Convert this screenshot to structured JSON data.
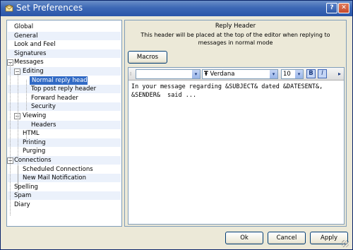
{
  "window": {
    "title": "Set Preferences",
    "help_glyph": "?",
    "close_glyph": "✕"
  },
  "tree": {
    "items": [
      {
        "label": "Global"
      },
      {
        "label": "General"
      },
      {
        "label": "Look and Feel"
      },
      {
        "label": "Signatures"
      },
      {
        "label": "Messages",
        "expanded": true
      },
      {
        "label": "Editing",
        "expanded": true
      },
      {
        "label": "Normal reply header",
        "selected": true
      },
      {
        "label": "Top post reply header"
      },
      {
        "label": "Forward header"
      },
      {
        "label": "Security"
      },
      {
        "label": "Viewing",
        "expanded": true
      },
      {
        "label": "Headers"
      },
      {
        "label": "HTML"
      },
      {
        "label": "Printing"
      },
      {
        "label": "Purging"
      },
      {
        "label": "Connections",
        "expanded": true
      },
      {
        "label": "Scheduled Connections"
      },
      {
        "label": "New Mail Notification"
      },
      {
        "label": "Spelling"
      },
      {
        "label": "Spam"
      },
      {
        "label": "Diary"
      }
    ],
    "expander_glyph": "−"
  },
  "panel": {
    "title": "Reply Header",
    "description": "This header will be placed at the top of the editor when replying to messages in normal mode",
    "macros_label": "Macros"
  },
  "editor": {
    "style_combo_value": "",
    "font_value": "Verdana",
    "font_icon": "truetype-icon",
    "font_glyph": "Ŧ",
    "size_value": "10",
    "bold_label": "B",
    "italic_label": "I",
    "dropdown_glyph": "▾",
    "grip_glyph": "⁝",
    "scroll_glyph": "▸",
    "text": "In your message regarding &SUBJECT& dated &DATESENT&,\n&SENDER&  said ..."
  },
  "buttons": {
    "ok": "Ok",
    "cancel": "Cancel",
    "apply": "Apply"
  },
  "colors": {
    "accent": "#316ac5",
    "titlebar": "#2a55a8",
    "tree_stripe": "#ebf1fb"
  }
}
